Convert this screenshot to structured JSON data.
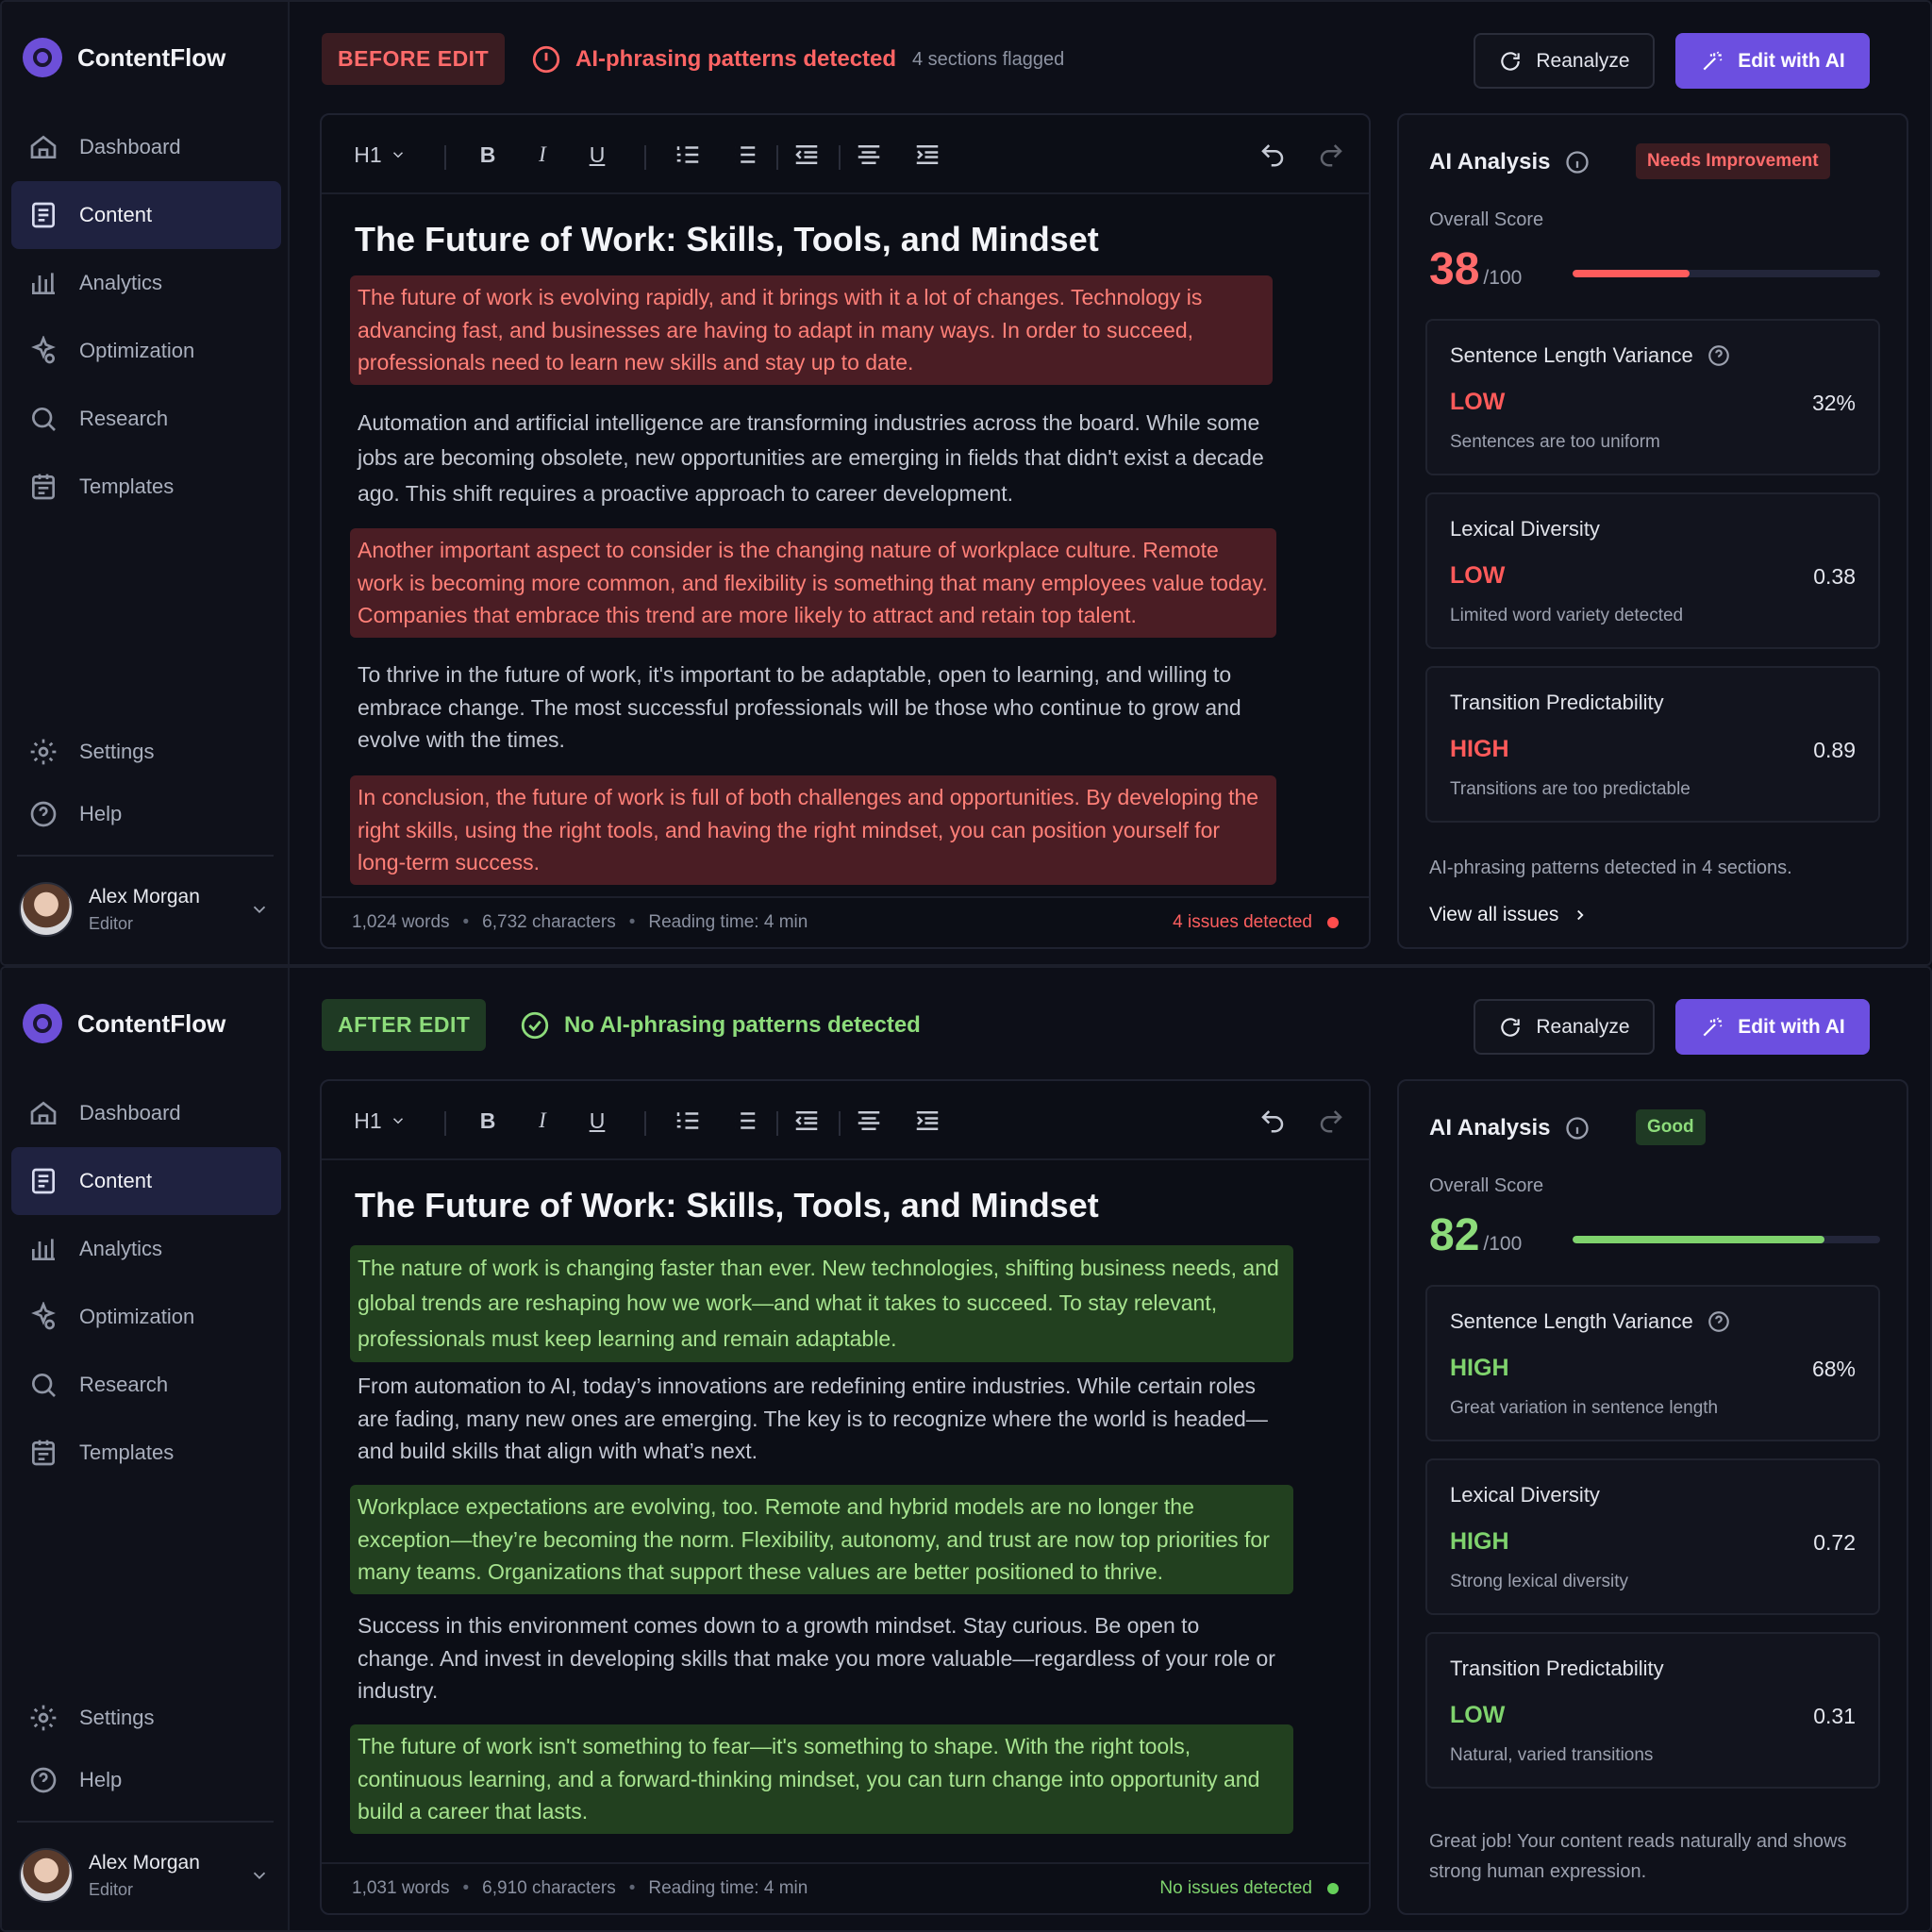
{
  "panels": [
    {
      "sidebar": {
        "brand": "ContentFlow",
        "nav": [
          "Dashboard",
          "Content",
          "Analytics",
          "Optimization",
          "Research",
          "Templates"
        ],
        "bottom": [
          "Settings",
          "Help"
        ],
        "user": {
          "name": "Alex Morgan",
          "role": "Editor"
        }
      },
      "topbar": {
        "state_label": "BEFORE EDIT",
        "status": "AI-phrasing patterns detected",
        "flagged": "4 sections flagged",
        "reanalyze": "Reanalyze",
        "edit_ai": "Edit with AI"
      },
      "editor": {
        "heading_select": "H1",
        "title": "The Future of Work: Skills, Tools, and Mindset",
        "paragraphs": [
          "The future of work is evolving rapidly, and it brings with it a lot of changes. Technology is advancing fast, and businesses are having to adapt in many ways. In order to succeed, professionals need to learn new skills and stay up to date.",
          "Automation and artificial intelligence are transforming industries across the board. While some jobs are becoming obsolete, new opportunities are emerging in fields that didn't exist a decade ago. This shift requires a proactive approach to career development.",
          "Another important aspect to consider is the changing nature of workplace culture. Remote work is becoming more common, and flexibility is something that many employees value today. Companies that embrace this trend are more likely to attract and retain top talent.",
          "To thrive in the future of work, it's important to be adaptable, open to learning, and willing to embrace change. The most successful professionals will be those who continue to grow and evolve with the times.",
          "In conclusion, the future of work is full of both challenges and opportunities. By developing the right skills, using the right tools, and having the right mindset, you can position yourself for long-term success."
        ],
        "footer": {
          "words": "1,024 words",
          "chars": "6,732 characters",
          "reading": "Reading time: 4 min",
          "issues": "4 issues detected"
        }
      },
      "analysis": {
        "title": "AI Analysis",
        "badge": "Needs Improvement",
        "score_label": "Overall Score",
        "score": "38",
        "score_den": "/100",
        "score_fraction": 0.38,
        "metrics": [
          {
            "name": "Sentence Length Variance",
            "level": "LOW",
            "value": "32%",
            "desc": "Sentences are too uniform"
          },
          {
            "name": "Lexical Diversity",
            "level": "LOW",
            "value": "0.38",
            "desc": "Limited word variety detected"
          },
          {
            "name": "Transition Predictability",
            "level": "HIGH",
            "value": "0.89",
            "desc": "Transitions are too predictable"
          }
        ],
        "note": "AI-phrasing patterns detected in 4 sections.",
        "view_all": "View all issues"
      }
    },
    {
      "sidebar": {
        "brand": "ContentFlow",
        "nav": [
          "Dashboard",
          "Content",
          "Analytics",
          "Optimization",
          "Research",
          "Templates"
        ],
        "bottom": [
          "Settings",
          "Help"
        ],
        "user": {
          "name": "Alex Morgan",
          "role": "Editor"
        }
      },
      "topbar": {
        "state_label": "AFTER EDIT",
        "status": "No AI-phrasing patterns detected",
        "reanalyze": "Reanalyze",
        "edit_ai": "Edit with AI"
      },
      "editor": {
        "heading_select": "H1",
        "title": "The Future of Work: Skills, Tools, and Mindset",
        "paragraphs": [
          "The nature of work is changing faster than ever. New technologies, shifting business needs, and global trends are reshaping how we work—and what it takes to succeed. To stay relevant, professionals must keep learning and remain adaptable.",
          "From automation to AI, today’s innovations are redefining entire industries. While certain roles are fading, many new ones are emerging. The key is to recognize where the world is headed—and build skills that align with what’s next.",
          "Workplace expectations are evolving, too. Remote and hybrid models are no longer the exception—they’re becoming the norm. Flexibility, autonomy, and trust are now top priorities for many teams. Organizations that support these values are better positioned to thrive.",
          "Success in this environment comes down to a growth mindset. Stay curious. Be open to change. And invest in developing skills that make you more valuable—regardless of your role or industry.",
          "The future of work isn't something to fear—it's something to shape. With the right tools, continuous learning, and a forward-thinking mindset, you can turn change into opportunity and build a career that lasts."
        ],
        "footer": {
          "words": "1,031 words",
          "chars": "6,910 characters",
          "reading": "Reading time: 4 min",
          "issues": "No issues detected"
        }
      },
      "analysis": {
        "title": "AI Analysis",
        "badge": "Good",
        "score_label": "Overall Score",
        "score": "82",
        "score_den": "/100",
        "score_fraction": 0.82,
        "metrics": [
          {
            "name": "Sentence Length Variance",
            "level": "HIGH",
            "value": "68%",
            "desc": "Great variation in sentence length"
          },
          {
            "name": "Lexical Diversity",
            "level": "HIGH",
            "value": "0.72",
            "desc": "Strong lexical diversity"
          },
          {
            "name": "Transition Predictability",
            "level": "LOW",
            "value": "0.31",
            "desc": "Natural, varied transitions"
          }
        ],
        "note": "Great job! Your content reads naturally and shows strong human expression."
      }
    }
  ]
}
